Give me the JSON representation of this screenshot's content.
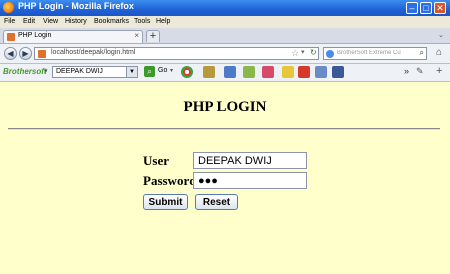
{
  "window": {
    "title": "PHP Login - Mozilla Firefox"
  },
  "menu": [
    "File",
    "Edit",
    "View",
    "History",
    "Bookmarks",
    "Tools",
    "Help"
  ],
  "tab": {
    "label": "PHP Login",
    "close": "×",
    "new_tab": "+"
  },
  "nav": {
    "url": "localhost/deepak/login.html",
    "search_placeholder": "BrotherSoft Extreme Cu"
  },
  "toolbar": {
    "brand": "Brothersoft",
    "select_value": "DEEPAK DWIJ",
    "go_label": "Go",
    "more": "»"
  },
  "page": {
    "heading": "PHP LOGIN",
    "user_label": "User",
    "user_value": "DEEPAK DWIJ",
    "password_label": "Password",
    "password_value": "●●●",
    "submit_label": "Submit",
    "reset_label": "Reset"
  },
  "colors": {
    "page_bg": "#ffffcc",
    "titlebar": "#1f62d6"
  }
}
